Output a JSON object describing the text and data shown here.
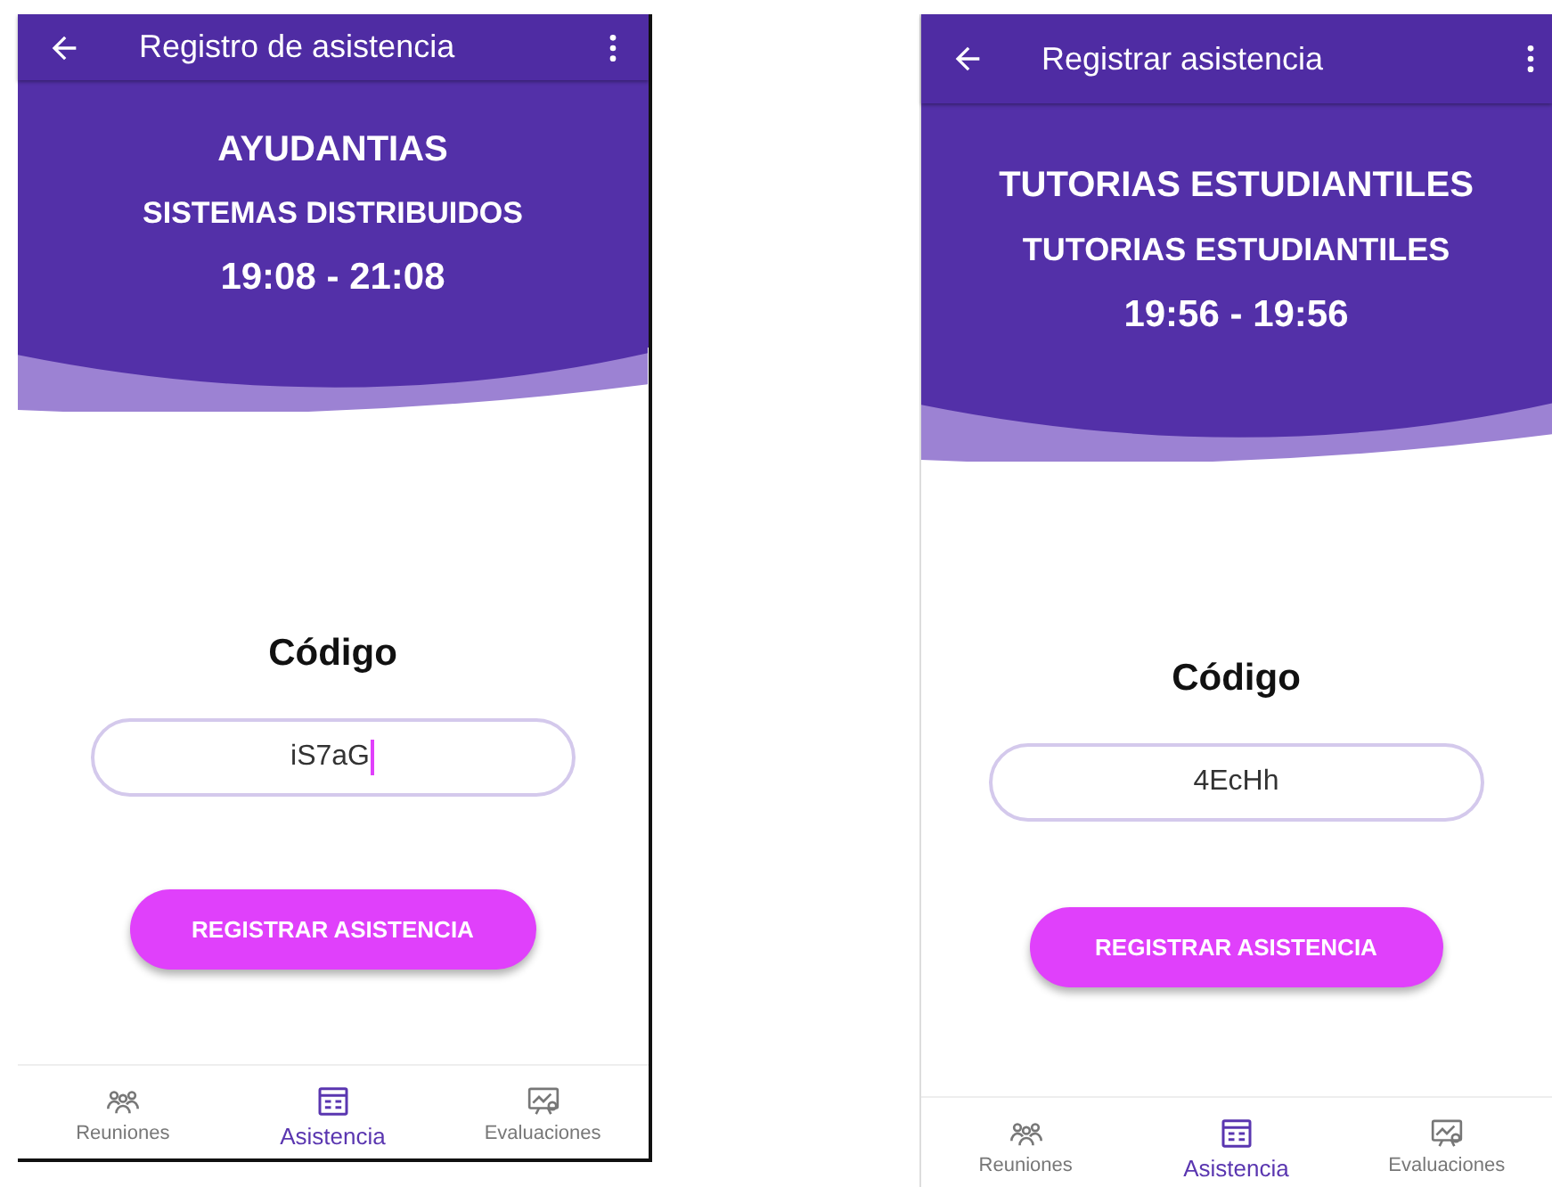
{
  "screens": [
    {
      "app_bar": {
        "title": "Registro de asistencia"
      },
      "header": {
        "category": "AYUDANTIAS",
        "subject": "SISTEMAS DISTRIBUIDOS",
        "time": "19:08 - 21:08"
      },
      "code_label": "Código",
      "code_field": {
        "value": "iS7aG",
        "focused": true
      },
      "button": "REGISTRAR ASISTENCIA",
      "nav": [
        {
          "label": "Reuniones",
          "kind": "people",
          "selected": false
        },
        {
          "label": "Asistencia",
          "kind": "list",
          "selected": true
        },
        {
          "label": "Evaluaciones",
          "kind": "chart",
          "selected": false
        }
      ]
    },
    {
      "app_bar": {
        "title": "Registrar asistencia"
      },
      "header": {
        "category": "TUTORIAS ESTUDIANTILES",
        "subject": "TUTORIAS ESTUDIANTILES",
        "time": "19:56 - 19:56"
      },
      "code_label": "Código",
      "code_field": {
        "value": "4EcHh",
        "focused": false
      },
      "button": "REGISTRAR ASISTENCIA",
      "nav": [
        {
          "label": "Reuniones",
          "kind": "people",
          "selected": false
        },
        {
          "label": "Asistencia",
          "kind": "list",
          "selected": true
        },
        {
          "label": "Evaluaciones",
          "kind": "chart",
          "selected": false
        }
      ]
    }
  ]
}
